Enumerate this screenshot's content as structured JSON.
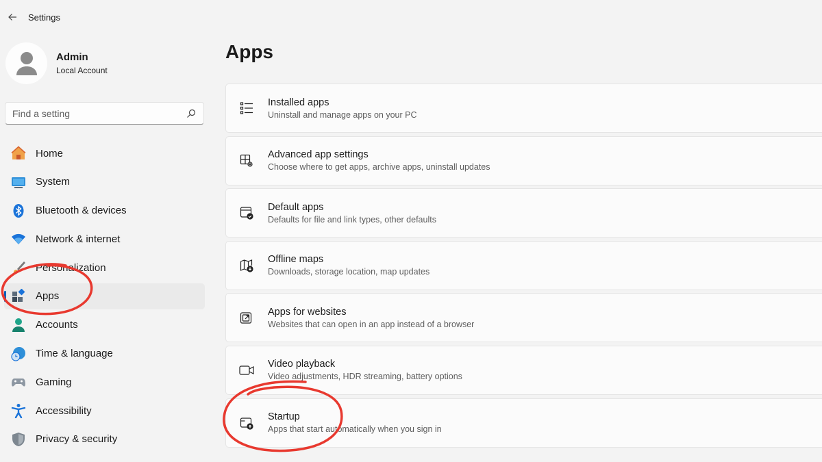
{
  "window": {
    "title": "Settings"
  },
  "profile": {
    "name": "Admin",
    "account_type": "Local Account"
  },
  "search": {
    "placeholder": "Find a setting"
  },
  "sidebar": {
    "items": [
      {
        "label": "Home",
        "icon": "home-icon",
        "active": false
      },
      {
        "label": "System",
        "icon": "system-icon",
        "active": false
      },
      {
        "label": "Bluetooth & devices",
        "icon": "bluetooth-icon",
        "active": false
      },
      {
        "label": "Network & internet",
        "icon": "wifi-icon",
        "active": false
      },
      {
        "label": "Personalization",
        "icon": "brush-icon",
        "active": false
      },
      {
        "label": "Apps",
        "icon": "apps-icon",
        "active": true
      },
      {
        "label": "Accounts",
        "icon": "person-icon",
        "active": false
      },
      {
        "label": "Time & language",
        "icon": "clock-globe-icon",
        "active": false
      },
      {
        "label": "Gaming",
        "icon": "gamepad-icon",
        "active": false
      },
      {
        "label": "Accessibility",
        "icon": "accessibility-icon",
        "active": false
      },
      {
        "label": "Privacy & security",
        "icon": "shield-icon",
        "active": false
      }
    ]
  },
  "main": {
    "title": "Apps",
    "cards": [
      {
        "title": "Installed apps",
        "description": "Uninstall and manage apps on your PC",
        "icon": "list-icon"
      },
      {
        "title": "Advanced app settings",
        "description": "Choose where to get apps, archive apps, uninstall updates",
        "icon": "app-settings-icon"
      },
      {
        "title": "Default apps",
        "description": "Defaults for file and link types, other defaults",
        "icon": "default-apps-icon"
      },
      {
        "title": "Offline maps",
        "description": "Downloads, storage location, map updates",
        "icon": "map-icon"
      },
      {
        "title": "Apps for websites",
        "description": "Websites that can open in an app instead of a browser",
        "icon": "open-external-icon"
      },
      {
        "title": "Video playback",
        "description": "Video adjustments, HDR streaming, battery options",
        "icon": "video-icon"
      },
      {
        "title": "Startup",
        "description": "Apps that start automatically when you sign in",
        "icon": "startup-icon"
      }
    ]
  },
  "colors": {
    "accent": "#005fb8",
    "annotation": "#e8392f",
    "background": "#f3f3f3",
    "card": "#fbfbfb"
  }
}
